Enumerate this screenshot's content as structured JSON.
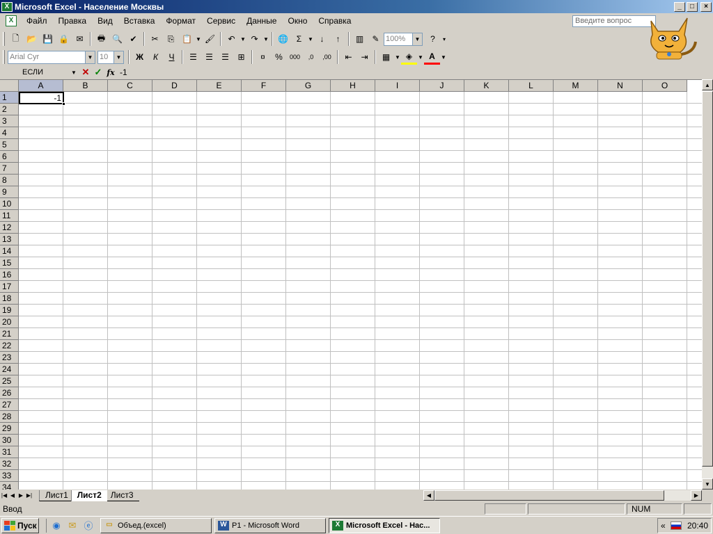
{
  "window": {
    "title": "Microsoft Excel - Население Москвы",
    "app_icon": "excel-icon",
    "minimize_label": "_",
    "maximize_label": "□",
    "close_label": "×",
    "doc_minimize_label": "_",
    "doc_restore_label": "❐",
    "doc_close_label": "×"
  },
  "menu": {
    "items": [
      "Файл",
      "Правка",
      "Вид",
      "Вставка",
      "Формат",
      "Сервис",
      "Данные",
      "Окно",
      "Справка"
    ],
    "help_placeholder": "Введите вопрос"
  },
  "toolbar_standard": {
    "zoom": "100%",
    "sum_symbol": "Σ",
    "help_symbol": "?"
  },
  "toolbar_format": {
    "font": "Arial Cyr",
    "size": "10",
    "bold": "Ж",
    "italic": "К",
    "underline": "Ч",
    "percent": "%",
    "thousands": "000",
    "inc_decimal": ",0",
    "dec_decimal": ",00"
  },
  "formula_bar": {
    "name_box": "ЕСЛИ",
    "cancel": "✕",
    "enter": "✓",
    "fx": "fx",
    "content": "-1"
  },
  "sheet": {
    "columns": [
      "A",
      "B",
      "C",
      "D",
      "E",
      "F",
      "G",
      "H",
      "I",
      "J",
      "K",
      "L",
      "M",
      "N",
      "O"
    ],
    "rows": [
      "1",
      "2",
      "3",
      "4",
      "5",
      "6",
      "7",
      "8",
      "9",
      "10",
      "11",
      "12",
      "13",
      "14",
      "15",
      "16",
      "17",
      "18",
      "19",
      "20",
      "21",
      "22",
      "23",
      "24",
      "25",
      "26",
      "27",
      "28",
      "29",
      "30",
      "31",
      "32",
      "33",
      "34"
    ],
    "active_column": "A",
    "active_row": "1",
    "active_cell_value": "-1",
    "tabs": [
      "Лист1",
      "Лист2",
      "Лист3"
    ],
    "active_tab": "Лист2"
  },
  "status": {
    "mode": "Ввод",
    "num": "NUM"
  },
  "taskbar": {
    "start": "Пуск",
    "buttons": [
      {
        "label": "Объед.(excel)",
        "icon": "folder-icon"
      },
      {
        "label": "P1 - Microsoft Word",
        "icon": "word-icon"
      },
      {
        "label": "Microsoft Excel - Нас...",
        "icon": "excel-icon"
      }
    ],
    "tray_chevron": "«",
    "clock": "20:40"
  },
  "colors": {
    "title_gradient_start": "#0a246a",
    "excel_green": "#1d7a34",
    "chrome": "#d4d0c8",
    "active_header": "#b6bdd2"
  }
}
